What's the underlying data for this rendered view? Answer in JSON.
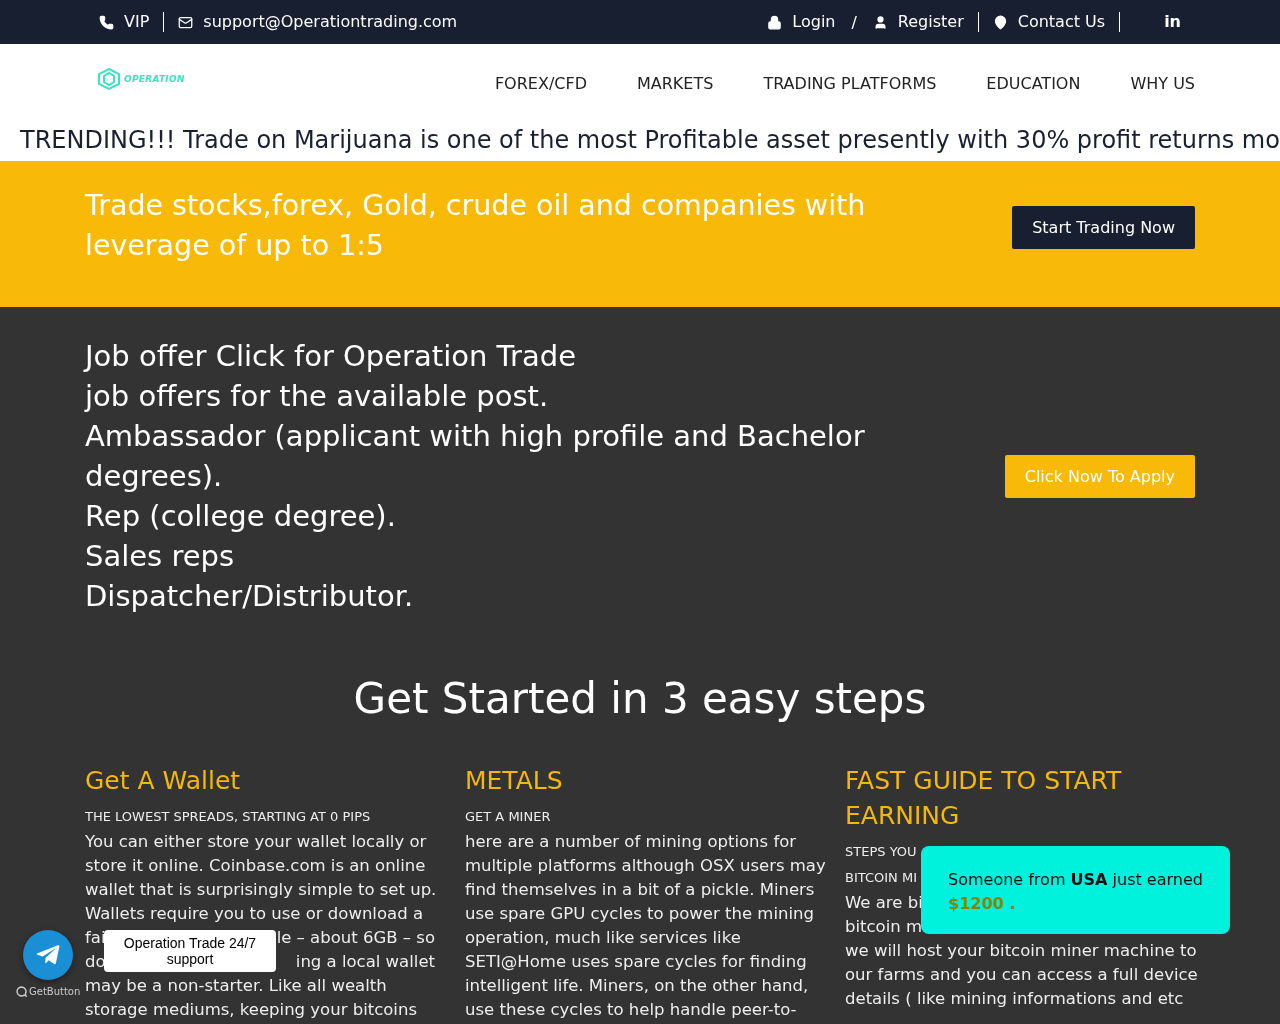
{
  "top_bar": {
    "left": [
      {
        "kind": "phone",
        "label": "VIP"
      },
      {
        "kind": "mail",
        "label": "support@Operationtrading.com"
      }
    ],
    "right": [
      {
        "kind": "lock",
        "label": "Login"
      },
      {
        "kind": "slash",
        "label": "/"
      },
      {
        "kind": "user",
        "label": "Register"
      },
      {
        "kind": "pin",
        "label": "Contact Us"
      },
      {
        "kind": "linkedin",
        "label": "in"
      }
    ]
  },
  "nav": {
    "logo_text": "OPERATION",
    "items": [
      "FOREX/CFD",
      "MARKETS",
      "TRADING PLATFORMS",
      "EDUCATION",
      "WHY US"
    ]
  },
  "ticker": "TRENDING!!! Trade on Marijuana is one of the most Profitable asset presently with 30% profit returns mo",
  "banner": {
    "text": "Trade stocks,forex, Gold, crude oil and companies with leverage of up to 1:5",
    "button": "Start Trading Now"
  },
  "job_offer": {
    "lines": [
      "Job offer Click for Operation Trade",
      "job offers for the available post.",
      "Ambassador (applicant with high profile and Bachelor",
      "degrees).",
      "Rep (college degree).",
      "Sales reps",
      "Dispatcher/Distributor."
    ],
    "button": "Click Now To Apply"
  },
  "steps": {
    "heading": "Get Started in 3 easy steps",
    "columns": [
      {
        "title": "Get A Wallet",
        "subtitles": [
          "THE LOWEST SPREADS, STARTING AT 0 PIPS"
        ],
        "lines": [
          [
            "You can either store your wallet locally or"
          ],
          [
            "store it online. Coinbase.com is an online"
          ],
          [
            "wallet that is surprisingly simple to set up."
          ],
          [
            "Wallets require you to use or download a"
          ],
          [
            "fai",
            "le – about 6GB – so"
          ],
          [
            "do",
            "ing a local wallet"
          ],
          [
            "may be a non-starter. Like all wealth"
          ],
          [
            "storage mediums, keeping your bitcoins"
          ]
        ]
      },
      {
        "title": "METALS",
        "subtitles": [
          "GET A MINER"
        ],
        "lines": [
          [
            "here are a number of mining options for"
          ],
          [
            "multiple platforms although OSX users may"
          ],
          [
            "find themselves in a bit of a pickle. Miners"
          ],
          [
            "use spare GPU cycles to power the mining"
          ],
          [
            "operation, much like services like"
          ],
          [
            "SETI@Home uses spare cycles for finding"
          ],
          [
            "intelligent life. Miners, on the other hand,"
          ],
          [
            "use these cycles to help handle peer-to-"
          ]
        ]
      },
      {
        "title": "FAST GUIDE TO START EARNING",
        "subtitles": [
          "STEPS YOU",
          "BITCOIN MI"
        ],
        "lines": [
          [
            "We are bi"
          ],
          [
            "bitcoin m"
          ],
          [
            "we will host your bitcoin miner machine to"
          ],
          [
            "our farms and you can access a full device"
          ],
          [
            "details ( like mining informations and etc"
          ]
        ]
      }
    ]
  },
  "support_widget": {
    "tooltip": "Operation Trade 24/7 support",
    "brand": "GetButton"
  },
  "notification": {
    "message": "Someone from **USA** just earned",
    "amount": "$1200 ."
  }
}
